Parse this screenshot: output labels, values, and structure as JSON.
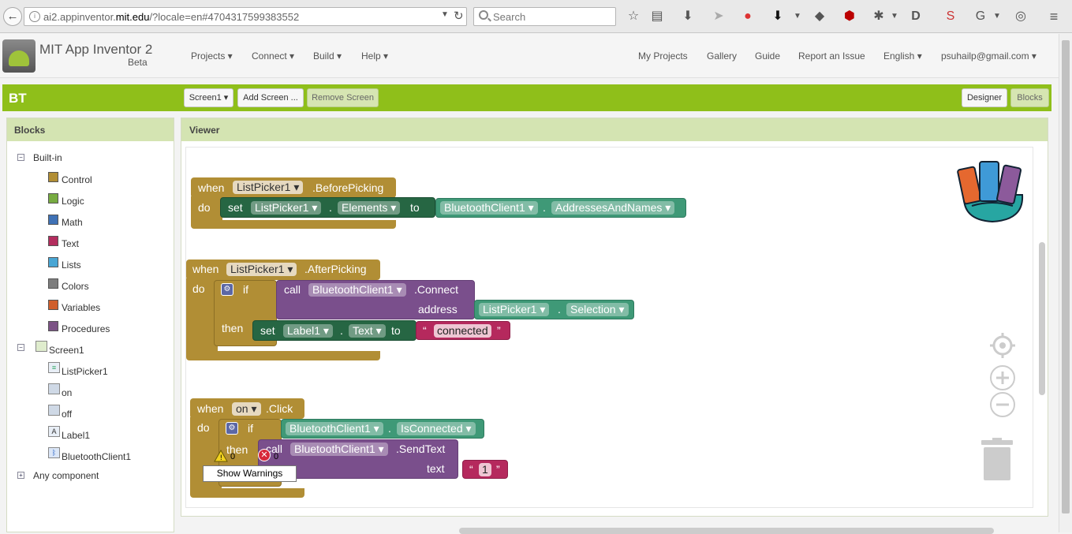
{
  "browser": {
    "url_prefix": "ai2.appinventor.",
    "url_domain": "mit.edu",
    "url_suffix": "/?locale=en#4704317599383552",
    "search_placeholder": "Search"
  },
  "app": {
    "title": "MIT App Inventor 2",
    "beta": "Beta",
    "menus_left": [
      "Projects ▾",
      "Connect ▾",
      "Build ▾",
      "Help ▾"
    ],
    "menus_right": [
      "My Projects",
      "Gallery",
      "Guide",
      "Report an Issue",
      "English ▾",
      "psuhailp@gmail.com ▾"
    ]
  },
  "project": {
    "name": "BT",
    "screen_select": "Screen1 ▾",
    "add_screen": "Add Screen ...",
    "remove_screen": "Remove Screen",
    "designer": "Designer",
    "blocks": "Blocks"
  },
  "palette": {
    "title": "Blocks",
    "builtin": "Built-in",
    "builtin_items": [
      {
        "label": "Control",
        "color": "#b18e35"
      },
      {
        "label": "Logic",
        "color": "#77ab41"
      },
      {
        "label": "Math",
        "color": "#3f71b5"
      },
      {
        "label": "Text",
        "color": "#b32d5e"
      },
      {
        "label": "Lists",
        "color": "#49a6d4"
      },
      {
        "label": "Colors",
        "color": "#7d7d7d"
      },
      {
        "label": "Variables",
        "color": "#d05f2d"
      },
      {
        "label": "Procedures",
        "color": "#7c5385"
      }
    ],
    "screen": "Screen1",
    "components": [
      "ListPicker1",
      "on",
      "off",
      "Label1",
      "BluetoothClient1"
    ],
    "any_component": "Any component"
  },
  "viewer": {
    "title": "Viewer",
    "block1": {
      "when": "when",
      "comp": "ListPicker1",
      "event": ".BeforePicking",
      "do": "do",
      "set": "set",
      "setcomp": "ListPicker1",
      "dot": ".",
      "prop": "Elements",
      "to": "to",
      "bt": "BluetoothClient1",
      "btprop": "AddressesAndNames"
    },
    "block2": {
      "when": "when",
      "comp": "ListPicker1",
      "event": ".AfterPicking",
      "do": "do",
      "if": "if",
      "call": "call",
      "callcomp": "BluetoothClient1",
      "method": ".Connect",
      "address": "address",
      "lp": "ListPicker1",
      "dot": ".",
      "sel": "Selection",
      "then": "then",
      "set": "set",
      "label": "Label1",
      "text": "Text",
      "to": "to",
      "oq": "“",
      "str": "connected",
      "cq": "”"
    },
    "block3": {
      "when": "when",
      "comp": "on",
      "event": ".Click",
      "do": "do",
      "if": "if",
      "bt": "BluetoothClient1",
      "dot": ".",
      "conn": "IsConnected",
      "then": "then",
      "call": "call",
      "callcomp": "BluetoothClient1",
      "method": ".SendText",
      "textlbl": "text",
      "oq": "“",
      "str": "1",
      "cq": "”"
    },
    "warnings_count": "0",
    "errors_count": "0",
    "show_warnings": "Show Warnings"
  }
}
